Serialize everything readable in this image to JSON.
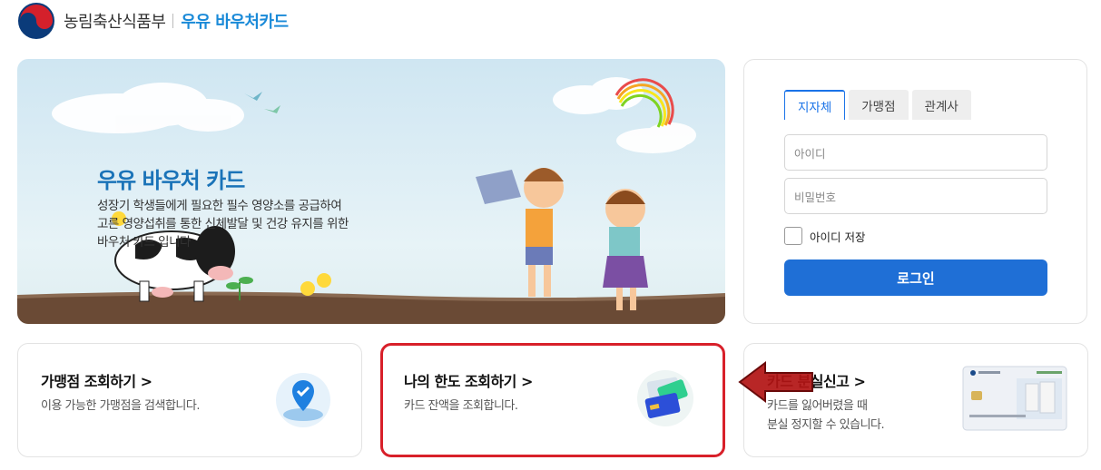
{
  "header": {
    "ministry": "농림축산식품부",
    "service": "우유 바우처카드",
    "logo_icon": "korea-emblem-icon"
  },
  "banner": {
    "title": "우유 바우처 카드",
    "description": [
      "성장기 학생들에게 필요한 필수 영양소를 공급하여",
      "고른 영양섭취를 통한 신체발달 및 건강 유지를 위한",
      "바우처 카드 입니다"
    ]
  },
  "login": {
    "tabs": [
      "지자체",
      "가맹점",
      "관계사"
    ],
    "active_tab": "지자체",
    "id_placeholder": "아이디",
    "password_placeholder": "비밀번호",
    "remember_label": "아이디 저장",
    "button_label": "로그인",
    "accent_color": "#1f6fd6"
  },
  "cards": [
    {
      "title": "가맹점 조회하기 >",
      "desc": [
        "이용 가능한 가맹점을 검색합니다."
      ],
      "icon": "map-pin-icon"
    },
    {
      "title": "나의 한도 조회하기 >",
      "desc": [
        "카드 잔액을 조회합니다."
      ],
      "icon": "card-money-icon",
      "highlight_color": "#d8202a"
    },
    {
      "title": "카드 분실신고 >",
      "desc": [
        "카드를 잃어버렸을 때",
        "분실 정지할 수 있습니다."
      ],
      "icon": "voucher-card-image"
    }
  ],
  "overlay": {
    "arrow_icon": "red-left-arrow-icon",
    "arrow_color": "#a01010"
  }
}
